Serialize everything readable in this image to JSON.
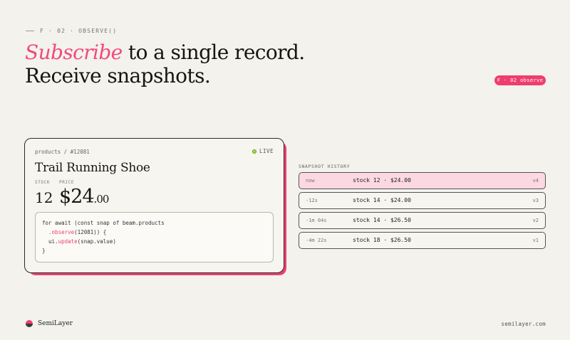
{
  "eyebrow": "F · 02 · OBSERVE()",
  "headline": {
    "accent": "Subscribe",
    "line1_rest": " to a single record.",
    "line2": "Receive snapshots."
  },
  "tag_pill": "F · 02 observe",
  "card": {
    "path": "products / #12081",
    "live_label": "LIVE",
    "title": "Trail Running Shoe",
    "stock_label": "STOCK",
    "price_label": "PRICE",
    "stock_value": "12",
    "price_main": "$24",
    "price_cents": ".00",
    "code": {
      "line1": "for await (const snap of beam.products",
      "line2_fn": ".observe",
      "line2_rest": "(12081)) {",
      "line3_obj": "ui.",
      "line3_fn": "update",
      "line3_rest": "(snap.value)",
      "line4": "}"
    }
  },
  "history": {
    "label": "SNAPSHOT HISTORY",
    "rows": [
      {
        "ago": "now",
        "value": "stock 12 · $24.00",
        "version": "v4",
        "active": true
      },
      {
        "ago": "-12s",
        "value": "stock 14 · $24.00",
        "version": "v3",
        "active": false
      },
      {
        "ago": "-1m 04s",
        "value": "stock 14 · $26.50",
        "version": "v2",
        "active": false
      },
      {
        "ago": "-4m 22s",
        "value": "stock 18 · $26.50",
        "version": "v1",
        "active": false
      }
    ]
  },
  "footer": {
    "brand": "SemiLayer",
    "url": "semilayer.com"
  },
  "colors": {
    "accent": "#ef3e6e",
    "background": "#f3f2ec",
    "live": "#a6d64a",
    "active_row": "#fcd8e2"
  }
}
